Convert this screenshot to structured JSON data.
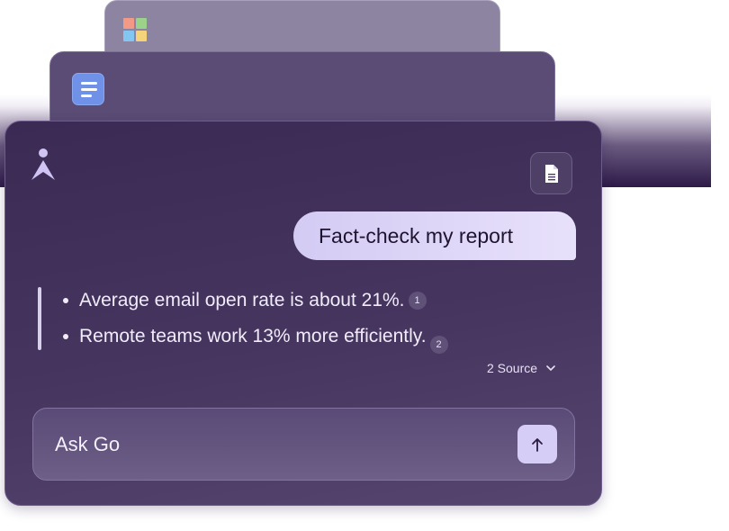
{
  "colors": {
    "card_bg": "#3a2a54",
    "user_bubble": "#d3cbf3",
    "send_button": "#d6cdf6",
    "docs_blue": "#6f92e8",
    "ms_red": "#f39a86",
    "ms_green": "#9bd38a",
    "ms_blue": "#84c6f2",
    "ms_yellow": "#f5d37a"
  },
  "background_apps": [
    {
      "icon": "microsoft-logo-icon"
    },
    {
      "icon": "google-docs-icon"
    }
  ],
  "header": {
    "logo_icon": "go-logo-icon",
    "attach_icon": "document-icon"
  },
  "chat": {
    "user_message": "Fact-check my report",
    "answer_items": [
      {
        "text": "Average email open rate is about 21%.",
        "citation": "1"
      },
      {
        "text": "Remote teams work 13% more efficiently.",
        "citation": "2"
      }
    ],
    "sources_label": "2 Source",
    "sources_icon": "chevron-down-icon"
  },
  "composer": {
    "placeholder": "Ask Go",
    "send_icon": "arrow-up-icon"
  }
}
